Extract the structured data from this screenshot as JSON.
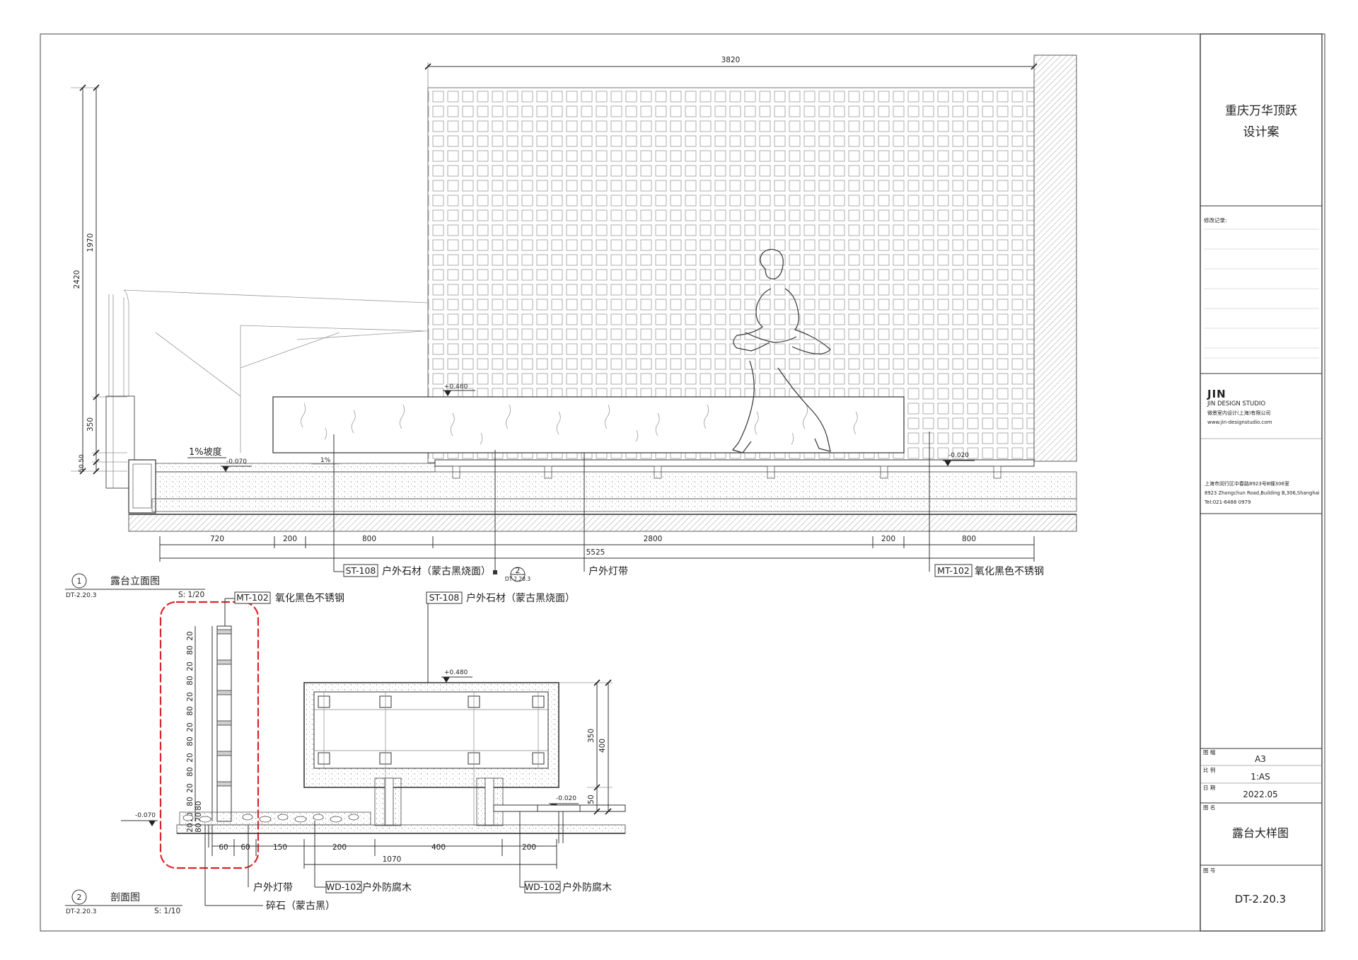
{
  "project": {
    "title_line1": "重庆万华顶跃",
    "title_line2": "设计案",
    "revision_label": "修改记录:"
  },
  "studio": {
    "logo_mark": "JIN",
    "name": "JIN DESIGN STUDIO",
    "name_cn": "微景室内设计(上海)有限公司",
    "website": "www.jin-designstudio.com",
    "address_cn": "上海市闵行区中春路8923号B幢306室",
    "address_en": "8923 Zhongchun Road,Building B,306,Shanghai",
    "tel": "Tel:021-6488 0979"
  },
  "info": {
    "size_label": "图 幅",
    "size_value": "A3",
    "scale_label": "比 例",
    "scale_value": "1:AS",
    "date_label": "日 期",
    "date_value": "2022.05",
    "name_label": "图 名",
    "drawing_name": "露台大样图",
    "number_label": "图 号",
    "drawing_number": "DT-2.20.3"
  },
  "elevation": {
    "tag_number": "1",
    "tag_ref": "DT-2.20.3",
    "title": "露台立面图",
    "scale": "S: 1/20",
    "dim_top": "3820",
    "dim_v_2420": "2420",
    "dim_v_1970": "1970",
    "dim_v_350": "350",
    "dim_v_50a": "50",
    "dim_v_50b": "50",
    "level_bench": "+0.480",
    "level_left": "-0.070",
    "level_right": "-0.020",
    "slope_text": "1%坡度",
    "slope_mark": "1%",
    "dims_bottom": [
      "720",
      "200",
      "800",
      "2800",
      "200",
      "800"
    ],
    "dim_total": "5525",
    "section_tag_number": "2",
    "section_tag_ref": "DT-2.20.3",
    "callouts": {
      "stone_code": "ST-108",
      "stone_text": "户外石材（蒙古黑烧面）",
      "light_text": "户外灯带",
      "steel_code": "MT-102",
      "steel_text": "氧化黑色不锈钢"
    }
  },
  "section": {
    "tag_number": "2",
    "tag_ref": "DT-2.20.3",
    "title": "剖面图",
    "scale": "S: 1/10",
    "steel_code": "MT-102",
    "steel_text": "氧化黑色不锈钢",
    "stone_code": "ST-108",
    "stone_text": "户外石材（蒙古黑烧面）",
    "level_bench": "+0.480",
    "level_left": "-0.070",
    "level_right": "-0.020",
    "dim_350": "350",
    "dim_400": "400",
    "dim_50": "50",
    "vertical_dims": [
      "20",
      "80",
      "20",
      "80",
      "20",
      "80",
      "20",
      "80",
      "20",
      "80",
      "20",
      "80",
      "20",
      "80",
      "20",
      "80",
      "20"
    ],
    "horizontal_dims": [
      "60",
      "60",
      "150",
      "200",
      "400",
      "200"
    ],
    "dim_total": "1070",
    "light_text": "户外灯带",
    "gravel_text": "碎石（蒙古黑）",
    "wood_code_1": "WD-102",
    "wood_text_1": "户外防腐木",
    "wood_code_2": "WD-102",
    "wood_text_2": "户外防腐木"
  },
  "colors": {
    "line": "#333333",
    "revision_cloud": "#d9262b",
    "paper": "#ffffff"
  }
}
